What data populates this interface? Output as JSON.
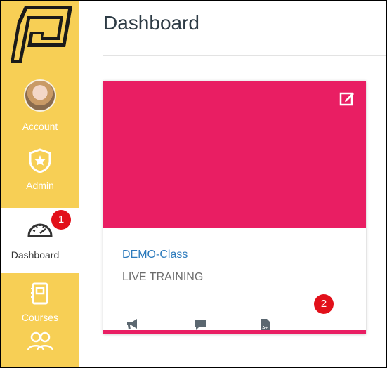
{
  "sidebar": {
    "items": [
      {
        "label": "Account"
      },
      {
        "label": "Admin"
      },
      {
        "label": "Dashboard"
      },
      {
        "label": "Courses"
      }
    ]
  },
  "header": {
    "title": "Dashboard"
  },
  "card": {
    "course_name": "DEMO-Class",
    "course_subtitle": "LIVE TRAINING",
    "color": "#e91e63"
  },
  "annotations": {
    "badge_1": "1",
    "badge_2": "2"
  },
  "colors": {
    "sidebar": "#f7cf55",
    "link": "#2b7abc",
    "badge": "#e2101a"
  }
}
